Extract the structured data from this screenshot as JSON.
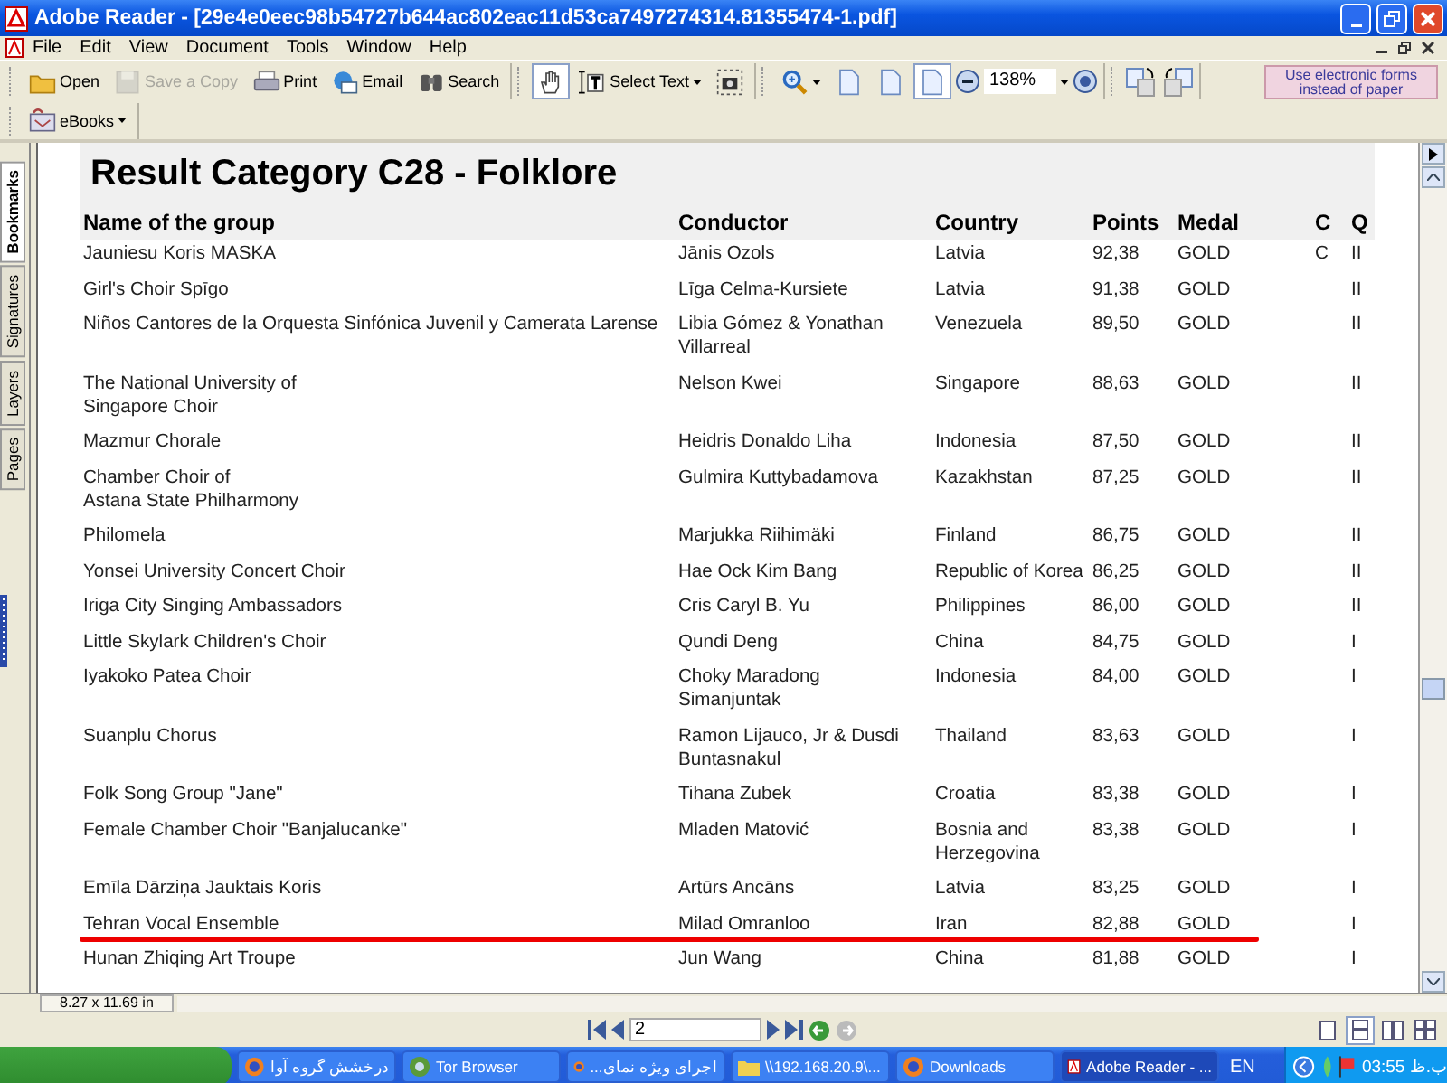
{
  "window": {
    "title": "Adobe Reader - [29e4e0eec98b54727b644ac802eac11d53ca7497274314.81355474-1.pdf]"
  },
  "menu_bar": [
    "File",
    "Edit",
    "View",
    "Document",
    "Tools",
    "Window",
    "Help"
  ],
  "file_tools": [
    {
      "label": "Open",
      "disabled": false
    },
    {
      "label": "Save a Copy",
      "disabled": true
    },
    {
      "label": "Print",
      "disabled": false
    },
    {
      "label": "Email",
      "disabled": false
    },
    {
      "label": "Search",
      "disabled": false
    }
  ],
  "select_tools": [
    {
      "selected": true
    },
    {
      "label": "Select Text",
      "selected": false
    },
    {
      "selected": false
    }
  ],
  "view_tools": [
    {
      "selected": false
    },
    {
      "selected": false
    },
    {
      "selected": false
    },
    {
      "selected": true
    }
  ],
  "zoom": {
    "value": "138%"
  },
  "promo": "Use electronic forms instead of paper",
  "ebooks": {
    "label": "eBooks"
  },
  "side_tabs": [
    {
      "label": "Bookmarks",
      "selected": true
    },
    {
      "label": "Signatures",
      "selected": false
    },
    {
      "label": "Layers",
      "selected": false
    },
    {
      "label": "Pages",
      "selected": false
    }
  ],
  "document": {
    "title": "Result Category C28 - Folklore",
    "columns": [
      "Name of the group",
      "Conductor",
      "Country",
      "Points",
      "Medal",
      "C",
      "Q"
    ],
    "rows": [
      {
        "name": "Jauniesu Koris MASKA",
        "conductor": "Jānis Ozols",
        "country": "Latvia",
        "points": "92,38",
        "medal": "GOLD",
        "c": "C",
        "q": "II",
        "underlined": false
      },
      {
        "name": "Girl's Choir Spīgo",
        "conductor": "Līga Celma-Kursiete",
        "country": "Latvia",
        "points": "91,38",
        "medal": "GOLD",
        "q": "II",
        "underlined": false
      },
      {
        "name": "Niños Cantores de la Orquesta Sinfónica Juvenil y Camerata Larense",
        "conductor": "Libia Gómez & Yonathan\nVillarreal",
        "country": "Venezuela",
        "points": "89,50",
        "medal": "GOLD",
        "q": "II",
        "underlined": false
      },
      {
        "name": "The National University of\nSingapore Choir",
        "conductor": "Nelson Kwei",
        "country": "Singapore",
        "points": "88,63",
        "medal": "GOLD",
        "q": "II",
        "underlined": false
      },
      {
        "name": "Mazmur Chorale",
        "conductor": "Heidris Donaldo Liha",
        "country": "Indonesia",
        "points": "87,50",
        "medal": "GOLD",
        "q": "II",
        "underlined": false
      },
      {
        "name": "Chamber Choir of\nAstana State Philharmony",
        "conductor": "Gulmira Kuttybadamova",
        "country": "Kazakhstan",
        "points": "87,25",
        "medal": "GOLD",
        "q": "II",
        "underlined": false
      },
      {
        "name": "Philomela",
        "conductor": "Marjukka Riihimäki",
        "country": "Finland",
        "points": "86,75",
        "medal": "GOLD",
        "q": "II",
        "underlined": false
      },
      {
        "name": "Yonsei University Concert Choir",
        "conductor": "Hae Ock Kim Bang",
        "country": "Republic of Korea",
        "points": "86,25",
        "medal": "GOLD",
        "q": "II",
        "underlined": false
      },
      {
        "name": "Iriga City Singing Ambassadors",
        "conductor": "Cris Caryl B. Yu",
        "country": "Philippines",
        "points": "86,00",
        "medal": "GOLD",
        "q": "II",
        "underlined": false
      },
      {
        "name": "Little Skylark Children's Choir",
        "conductor": "Qundi Deng",
        "country": "China",
        "points": "84,75",
        "medal": "GOLD",
        "q": "I",
        "underlined": false
      },
      {
        "name": "Iyakoko Patea Choir",
        "conductor": "Choky Maradong\nSimanjuntak",
        "country": "Indonesia",
        "points": "84,00",
        "medal": "GOLD",
        "q": "I",
        "underlined": false
      },
      {
        "name": "Suanplu Chorus",
        "conductor": "Ramon Lijauco, Jr & Dusdi\nBuntasnakul",
        "country": "Thailand",
        "points": "83,63",
        "medal": "GOLD",
        "q": "I",
        "underlined": false
      },
      {
        "name": "Folk Song Group \"Jane\"",
        "conductor": "Tihana Zubek",
        "country": "Croatia",
        "points": "83,38",
        "medal": "GOLD",
        "q": "I",
        "underlined": false
      },
      {
        "name": "Female Chamber Choir \"Banjalucanke\"",
        "conductor": "Mladen Matović",
        "country": "Bosnia and\nHerzegovina",
        "points": "83,38",
        "medal": "GOLD",
        "q": "I",
        "underlined": false
      },
      {
        "name": "Emīla Dārziņa Jauktais Koris",
        "conductor": "Artūrs Ancāns",
        "country": "Latvia",
        "points": "83,25",
        "medal": "GOLD",
        "q": "I",
        "underlined": false
      },
      {
        "name": "Tehran Vocal Ensemble",
        "conductor": "Milad Omranloo",
        "country": "Iran",
        "points": "82,88",
        "medal": "GOLD",
        "q": "I",
        "underlined": true
      },
      {
        "name": "Hunan Zhiqing Art Troupe",
        "conductor": "Jun Wang",
        "country": "China",
        "points": "81,88",
        "medal": "GOLD",
        "q": "I",
        "underlined": false
      }
    ]
  },
  "status_bar": {
    "page_size": "8.27 x 11.69 in"
  },
  "page_nav": {
    "page": "2"
  },
  "layout_buttons": [
    {
      "selected": false
    },
    {
      "selected": true
    },
    {
      "selected": false
    },
    {
      "selected": false
    }
  ],
  "taskbar": {
    "tasks": [
      {
        "label": "درخشش گروه آوا",
        "selected": false
      },
      {
        "label": "Tor Browser",
        "selected": false
      },
      {
        "label": "اجرای ویژه نمای...",
        "selected": false
      },
      {
        "label": "\\\\192.168.20.9\\...",
        "selected": false
      },
      {
        "label": "Downloads",
        "selected": false
      },
      {
        "label": "Adobe Reader - ...",
        "selected": true
      }
    ],
    "language": "EN",
    "clock": "03:55 ب.ظ"
  }
}
